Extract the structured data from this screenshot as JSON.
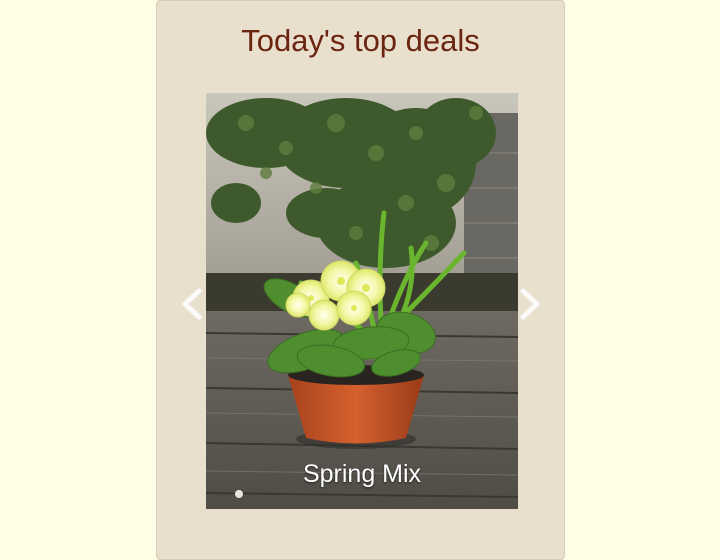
{
  "card": {
    "title": "Today's top deals",
    "background": "#e8dfcd",
    "title_color": "#6b2410"
  },
  "carousel": {
    "caption": "Spring Mix",
    "prev_icon": "chevron-left-icon",
    "next_icon": "chevron-right-icon"
  },
  "page": {
    "background": "#fefde6"
  }
}
